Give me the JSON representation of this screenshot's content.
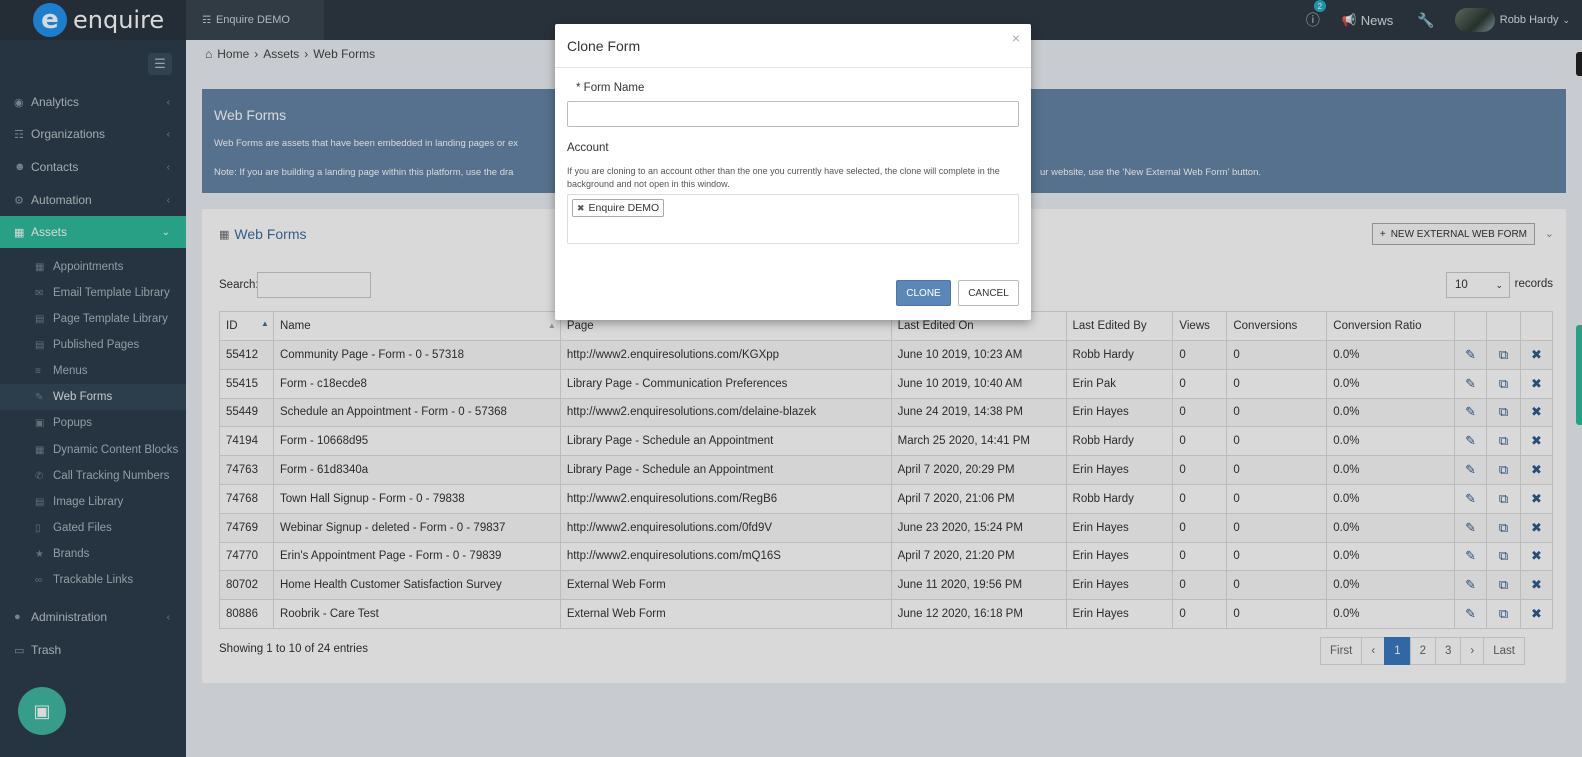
{
  "brand": {
    "logo_letter": "e",
    "name": "enquire"
  },
  "topbar": {
    "org_tab": "Enquire DEMO",
    "alert_count": "2",
    "news_label": "News",
    "user_name": "Robb Hardy"
  },
  "sidebar": {
    "items": [
      {
        "label": "Analytics"
      },
      {
        "label": "Organizations"
      },
      {
        "label": "Contacts"
      },
      {
        "label": "Automation"
      },
      {
        "label": "Assets"
      }
    ],
    "sub_items": [
      {
        "label": "Appointments"
      },
      {
        "label": "Email Template Library"
      },
      {
        "label": "Page Template Library"
      },
      {
        "label": "Published Pages"
      },
      {
        "label": "Menus"
      },
      {
        "label": "Web Forms"
      },
      {
        "label": "Popups"
      },
      {
        "label": "Dynamic Content Blocks"
      },
      {
        "label": "Call Tracking Numbers"
      },
      {
        "label": "Image Library"
      },
      {
        "label": "Gated Files"
      },
      {
        "label": "Brands"
      },
      {
        "label": "Trackable Links"
      }
    ],
    "bottom_items": [
      {
        "label": "Administration"
      },
      {
        "label": "Trash"
      }
    ]
  },
  "breadcrumb": {
    "home": "Home",
    "assets": "Assets",
    "current": "Web Forms"
  },
  "header": {
    "title": "Web Forms",
    "line1": "Web Forms are assets that have been embedded in landing pages or ex",
    "line2_left": "Note: If you are building a landing page within this platform, use the dra",
    "line2_right": "ur website, use the 'New External Web Form' button."
  },
  "panel": {
    "title": "Web Forms",
    "new_button": "NEW EXTERNAL WEB FORM",
    "search_label": "Search:",
    "records_value": "10",
    "records_label": "records",
    "columns": [
      "ID",
      "Name",
      "Page",
      "Last Edited On",
      "Last Edited By",
      "Views",
      "Conversions",
      "Conversion Ratio"
    ],
    "rows": [
      [
        "55412",
        "Community Page - Form - 0 - 57318",
        "http://www2.enquiresolutions.com/KGXpp",
        "June 10 2019, 10:23 AM",
        "Robb Hardy",
        "0",
        "0",
        "0.0%"
      ],
      [
        "55415",
        "Form - c18ecde8",
        "Library Page - Communication Preferences",
        "June 10 2019, 10:40 AM",
        "Erin Pak",
        "0",
        "0",
        "0.0%"
      ],
      [
        "55449",
        "Schedule an Appointment - Form - 0 - 57368",
        "http://www2.enquiresolutions.com/delaine-blazek",
        "June 24 2019, 14:38 PM",
        "Erin Hayes",
        "0",
        "0",
        "0.0%"
      ],
      [
        "74194",
        "Form - 10668d95",
        "Library Page - Schedule an Appointment",
        "March 25 2020, 14:41 PM",
        "Robb Hardy",
        "0",
        "0",
        "0.0%"
      ],
      [
        "74763",
        "Form - 61d8340a",
        "Library Page - Schedule an Appointment",
        "April 7 2020, 20:29 PM",
        "Erin Hayes",
        "0",
        "0",
        "0.0%"
      ],
      [
        "74768",
        "Town Hall Signup - Form - 0 - 79838",
        "http://www2.enquiresolutions.com/RegB6",
        "April 7 2020, 21:06 PM",
        "Robb Hardy",
        "0",
        "0",
        "0.0%"
      ],
      [
        "74769",
        "Webinar Signup - deleted - Form - 0 - 79837",
        "http://www2.enquiresolutions.com/0fd9V",
        "June 23 2020, 15:24 PM",
        "Erin Hayes",
        "0",
        "0",
        "0.0%"
      ],
      [
        "74770",
        "Erin's Appointment Page - Form - 0 - 79839",
        "http://www2.enquiresolutions.com/mQ16S",
        "April 7 2020, 21:20 PM",
        "Erin Hayes",
        "0",
        "0",
        "0.0%"
      ],
      [
        "80702",
        "Home Health Customer Satisfaction Survey",
        "External Web Form",
        "June 11 2020, 19:56 PM",
        "Erin Hayes",
        "0",
        "0",
        "0.0%"
      ],
      [
        "80886",
        "Roobrik - Care Test",
        "External Web Form",
        "June 12 2020, 16:18 PM",
        "Erin Hayes",
        "0",
        "0",
        "0.0%"
      ]
    ],
    "showing": "Showing 1 to 10 of 24 entries",
    "pager": {
      "first": "First",
      "prev": "‹",
      "pages": [
        "1",
        "2",
        "3"
      ],
      "next": "›",
      "last": "Last"
    }
  },
  "modal": {
    "title": "Clone Form",
    "close": "×",
    "form_name_label": "* Form Name",
    "form_name_value": "",
    "account_label": "Account",
    "note": "If you are cloning to an account other than the one you currently have selected, the clone will complete in the background and not open in this window.",
    "account_chip": "Enquire DEMO",
    "clone_button": "CLONE",
    "cancel_button": "CANCEL"
  }
}
